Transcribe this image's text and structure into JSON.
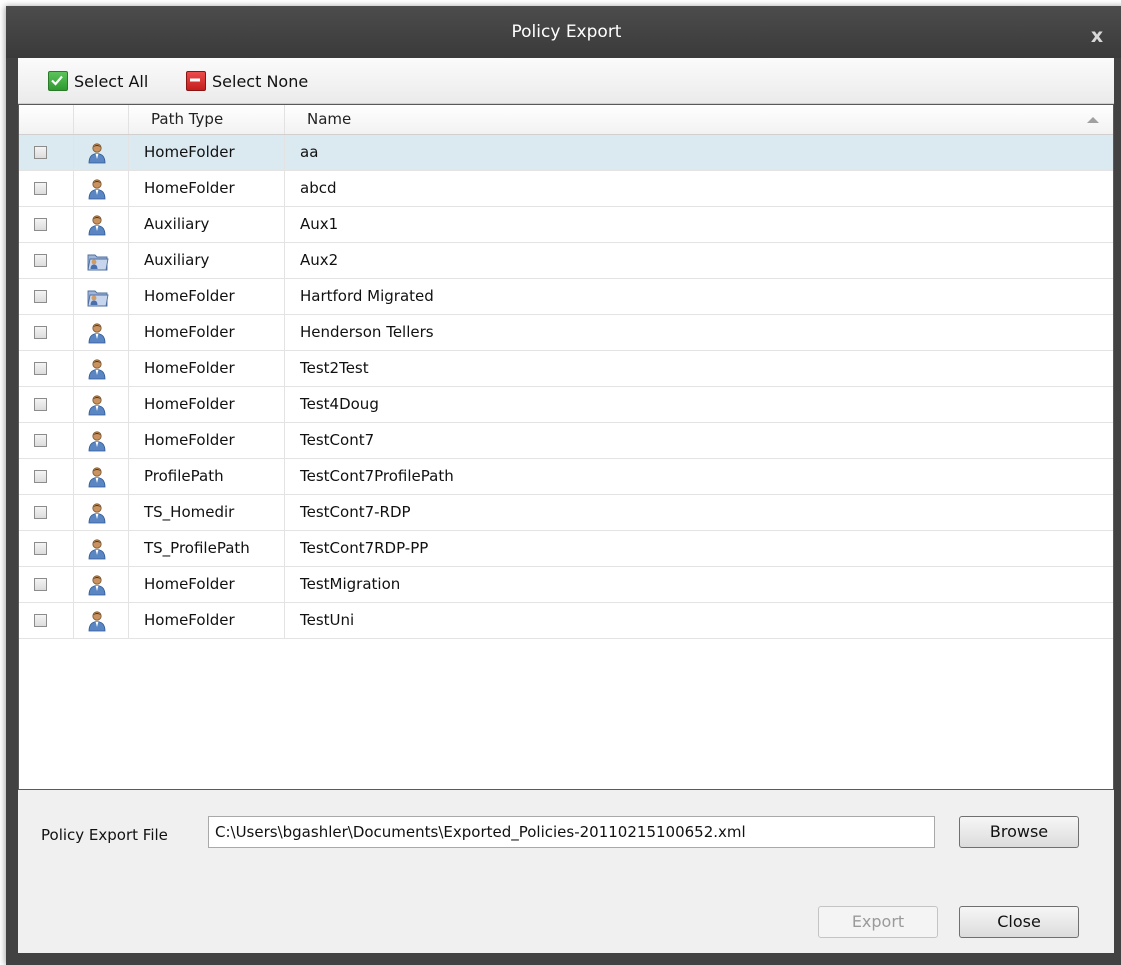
{
  "window": {
    "title": "Policy Export",
    "close_glyph": "x"
  },
  "toolbar": {
    "select_all": "Select All",
    "select_none": "Select None"
  },
  "grid": {
    "columns": [
      "",
      "",
      "Path Type",
      "Name"
    ],
    "rows": [
      {
        "path_type": "HomeFolder",
        "name": "aa",
        "icon": "user-icon",
        "selected": true
      },
      {
        "path_type": "HomeFolder",
        "name": "abcd",
        "icon": "user-icon"
      },
      {
        "path_type": "Auxiliary",
        "name": "Aux1",
        "icon": "user-icon"
      },
      {
        "path_type": "Auxiliary",
        "name": "Aux2",
        "icon": "folder-user-icon"
      },
      {
        "path_type": "HomeFolder",
        "name": "Hartford Migrated",
        "icon": "folder-user-icon"
      },
      {
        "path_type": "HomeFolder",
        "name": "Henderson Tellers",
        "icon": "user-icon"
      },
      {
        "path_type": "HomeFolder",
        "name": "Test2Test",
        "icon": "user-icon"
      },
      {
        "path_type": "HomeFolder",
        "name": "Test4Doug",
        "icon": "user-icon"
      },
      {
        "path_type": "HomeFolder",
        "name": "TestCont7",
        "icon": "user-icon"
      },
      {
        "path_type": "ProfilePath",
        "name": "TestCont7ProfilePath",
        "icon": "user-icon"
      },
      {
        "path_type": "TS_Homedir",
        "name": "TestCont7-RDP",
        "icon": "user-icon"
      },
      {
        "path_type": "TS_ProfilePath",
        "name": "TestCont7RDP-PP",
        "icon": "user-icon"
      },
      {
        "path_type": "HomeFolder",
        "name": "TestMigration",
        "icon": "user-icon"
      },
      {
        "path_type": "HomeFolder",
        "name": "TestUni",
        "icon": "user-icon"
      }
    ]
  },
  "export": {
    "file_label": "Policy Export File",
    "file_path": "C:\\Users\\bgashler\\Documents\\Exported_Policies-20110215100652.xml",
    "browse_label": "Browse",
    "export_label": "Export",
    "close_label": "Close"
  }
}
